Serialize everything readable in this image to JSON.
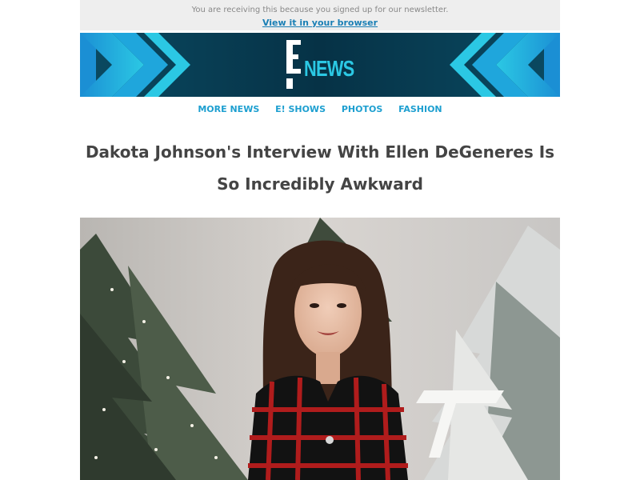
{
  "header": {
    "notice": "You are receiving this because you signed up for our newsletter.",
    "view_link": "View it in your browser"
  },
  "banner": {
    "logo_text": "NEWS",
    "brand_color": "#2bc8e4",
    "bg_color": "#063246"
  },
  "nav": {
    "items": [
      {
        "label": "MORE NEWS"
      },
      {
        "label": "E! SHOWS"
      },
      {
        "label": "PHOTOS"
      },
      {
        "label": "FASHION"
      }
    ],
    "link_color": "#1d9fd0"
  },
  "article": {
    "title_line1": "Dakota Johnson's Interview With Ellen DeGeneres Is",
    "title_line2": "So Incredibly Awkward"
  }
}
